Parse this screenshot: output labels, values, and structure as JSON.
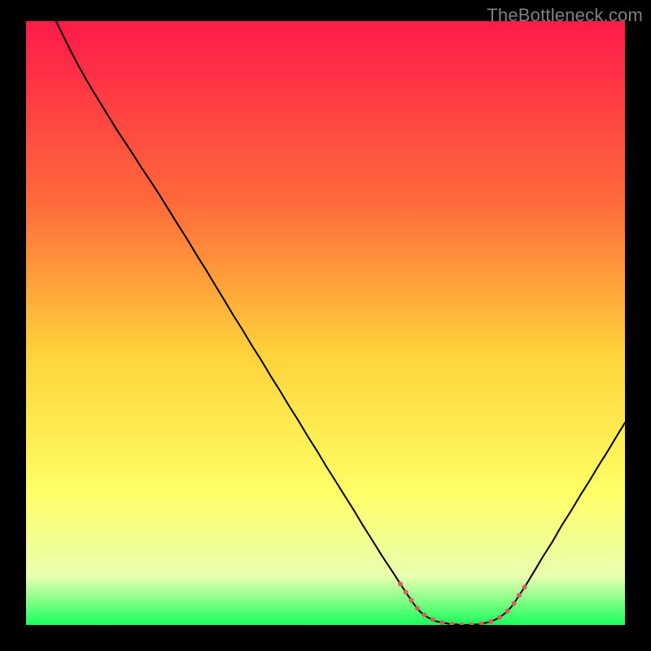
{
  "watermark": "TheBottleneck.com",
  "chart_data": {
    "type": "line",
    "title": "",
    "xlabel": "",
    "ylabel": "",
    "x_range": [
      0,
      100
    ],
    "y_range": [
      0,
      100
    ],
    "background_gradient": {
      "stops": [
        {
          "offset": 0,
          "color": "#ff1a4a"
        },
        {
          "offset": 30,
          "color": "#ff6a3a"
        },
        {
          "offset": 55,
          "color": "#ffd23a"
        },
        {
          "offset": 78,
          "color": "#ffff66"
        },
        {
          "offset": 92,
          "color": "#e8ffb0"
        },
        {
          "offset": 100,
          "color": "#19ff5a"
        }
      ]
    },
    "series": [
      {
        "name": "bottleneck-curve",
        "color": "#000000",
        "stroke_width": 2,
        "points": [
          {
            "x": 5.0,
            "y": 100.0
          },
          {
            "x": 6.2,
            "y": 97.6
          },
          {
            "x": 7.4,
            "y": 95.2
          },
          {
            "x": 8.6,
            "y": 92.9
          },
          {
            "x": 9.9,
            "y": 90.6
          },
          {
            "x": 11.2,
            "y": 88.4
          },
          {
            "x": 12.5,
            "y": 86.3
          },
          {
            "x": 13.8,
            "y": 84.2
          },
          {
            "x": 15.1,
            "y": 82.1
          },
          {
            "x": 16.5,
            "y": 80.0
          },
          {
            "x": 17.9,
            "y": 77.9
          },
          {
            "x": 19.3,
            "y": 75.7
          },
          {
            "x": 20.8,
            "y": 73.5
          },
          {
            "x": 22.3,
            "y": 71.2
          },
          {
            "x": 23.8,
            "y": 68.8
          },
          {
            "x": 25.3,
            "y": 66.4
          },
          {
            "x": 26.9,
            "y": 63.9
          },
          {
            "x": 28.4,
            "y": 61.4
          },
          {
            "x": 30.0,
            "y": 58.9
          },
          {
            "x": 31.5,
            "y": 56.4
          },
          {
            "x": 33.1,
            "y": 53.8
          },
          {
            "x": 34.6,
            "y": 51.3
          },
          {
            "x": 36.2,
            "y": 48.8
          },
          {
            "x": 37.7,
            "y": 46.3
          },
          {
            "x": 39.3,
            "y": 43.8
          },
          {
            "x": 40.8,
            "y": 41.3
          },
          {
            "x": 42.4,
            "y": 38.8
          },
          {
            "x": 43.9,
            "y": 36.3
          },
          {
            "x": 45.5,
            "y": 33.8
          },
          {
            "x": 47.0,
            "y": 31.3
          },
          {
            "x": 48.6,
            "y": 28.8
          },
          {
            "x": 50.1,
            "y": 26.3
          },
          {
            "x": 51.7,
            "y": 23.8
          },
          {
            "x": 53.2,
            "y": 21.4
          },
          {
            "x": 54.8,
            "y": 18.9
          },
          {
            "x": 56.3,
            "y": 16.4
          },
          {
            "x": 57.9,
            "y": 13.9
          },
          {
            "x": 59.4,
            "y": 11.5
          },
          {
            "x": 61.0,
            "y": 9.1
          },
          {
            "x": 62.5,
            "y": 6.8
          },
          {
            "x": 63.7,
            "y": 5.0
          },
          {
            "x": 64.8,
            "y": 3.4
          },
          {
            "x": 65.8,
            "y": 2.2
          },
          {
            "x": 67.0,
            "y": 1.3
          },
          {
            "x": 68.5,
            "y": 0.6
          },
          {
            "x": 70.5,
            "y": 0.2
          },
          {
            "x": 73.0,
            "y": 0.0
          },
          {
            "x": 75.5,
            "y": 0.1
          },
          {
            "x": 77.5,
            "y": 0.5
          },
          {
            "x": 79.0,
            "y": 1.2
          },
          {
            "x": 80.2,
            "y": 2.1
          },
          {
            "x": 81.2,
            "y": 3.2
          },
          {
            "x": 82.2,
            "y": 4.7
          },
          {
            "x": 83.4,
            "y": 6.5
          },
          {
            "x": 84.8,
            "y": 8.8
          },
          {
            "x": 86.3,
            "y": 11.3
          },
          {
            "x": 87.9,
            "y": 13.8
          },
          {
            "x": 89.4,
            "y": 16.4
          },
          {
            "x": 91.0,
            "y": 18.9
          },
          {
            "x": 92.5,
            "y": 21.4
          },
          {
            "x": 94.1,
            "y": 23.9
          },
          {
            "x": 95.6,
            "y": 26.4
          },
          {
            "x": 97.2,
            "y": 28.9
          },
          {
            "x": 98.7,
            "y": 31.4
          },
          {
            "x": 100.0,
            "y": 33.5
          }
        ]
      },
      {
        "name": "highlight-segment",
        "color": "#d66060",
        "stroke_width": 6,
        "dashed": true,
        "points": [
          {
            "x": 62.5,
            "y": 6.8
          },
          {
            "x": 63.7,
            "y": 5.0
          },
          {
            "x": 64.8,
            "y": 3.4
          },
          {
            "x": 65.8,
            "y": 2.2
          },
          {
            "x": 67.0,
            "y": 1.3
          },
          {
            "x": 68.5,
            "y": 0.6
          },
          {
            "x": 70.5,
            "y": 0.2
          },
          {
            "x": 73.0,
            "y": 0.0
          },
          {
            "x": 75.5,
            "y": 0.1
          },
          {
            "x": 77.5,
            "y": 0.5
          },
          {
            "x": 79.0,
            "y": 1.2
          },
          {
            "x": 80.2,
            "y": 2.1
          },
          {
            "x": 81.2,
            "y": 3.2
          },
          {
            "x": 82.2,
            "y": 4.7
          },
          {
            "x": 83.4,
            "y": 6.5
          }
        ]
      }
    ]
  }
}
